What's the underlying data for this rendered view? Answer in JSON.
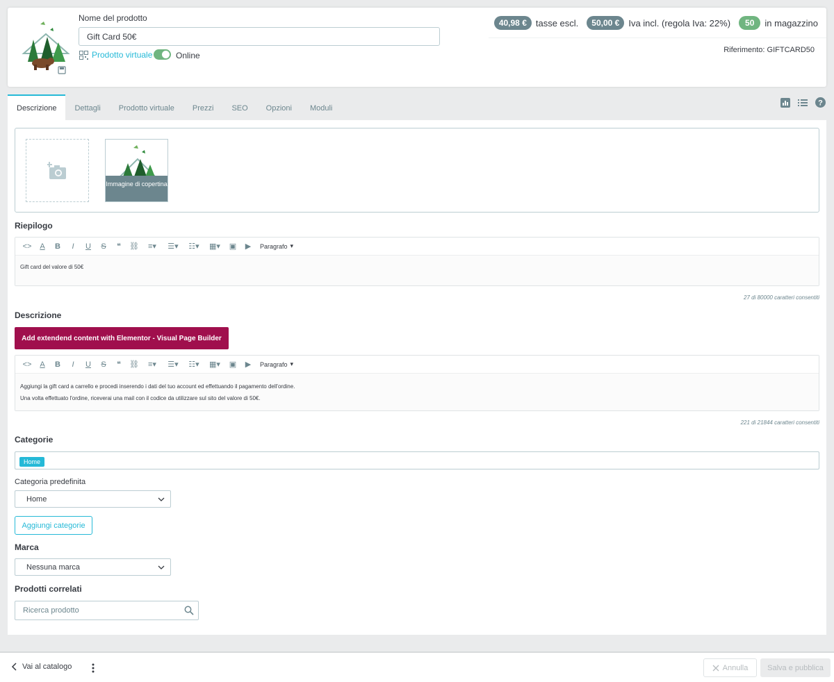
{
  "header": {
    "name_label": "Nome del prodotto",
    "name_value": "Gift Card 50€",
    "virtual_label": "Prodotto virtuale",
    "online_label": "Online",
    "online_enabled": true,
    "price_excl": "40,98 €",
    "price_excl_label": "tasse escl.",
    "price_incl": "50,00 €",
    "price_incl_label": "Iva incl. (regola Iva: 22%)",
    "stock": "50",
    "stock_label": "in magazzino",
    "reference": "Riferimento: GIFTCARD50"
  },
  "tabs": [
    {
      "label": "Descrizione",
      "active": true
    },
    {
      "label": "Dettagli"
    },
    {
      "label": "Prodotto virtuale"
    },
    {
      "label": "Prezzi"
    },
    {
      "label": "SEO"
    },
    {
      "label": "Opzioni"
    },
    {
      "label": "Moduli"
    }
  ],
  "images": {
    "cover_label": "Immagine di copertina"
  },
  "summary": {
    "title": "Riepilogo",
    "paragraph_label": "Paragrafo",
    "text": "Gift card del valore di 50€",
    "counter": "27 di 80000 caratteri consentiti"
  },
  "description": {
    "title": "Descrizione",
    "elementor_button": "Add extendend content with Elementor - Visual Page Builder",
    "paragraph_label": "Paragrafo",
    "line1": "Aggiungi la gift card a carrello e procedi inserendo i dati del tuo account ed effettuando il pagamento dell'ordine.",
    "line2": "Una volta effettuato l'ordine, riceverai una mail con il codice da utilizzare sul sito del valore di 50€.",
    "counter": "221 di 21844 caratteri consentiti"
  },
  "categories": {
    "title": "Categorie",
    "tag": "Home",
    "default_label": "Categoria predefinita",
    "default_value": "Home",
    "add_button": "Aggiungi categorie"
  },
  "brand": {
    "title": "Marca",
    "value": "Nessuna marca"
  },
  "related": {
    "title": "Prodotti correlati",
    "placeholder": "Ricerca prodotto"
  },
  "footer": {
    "back_label": "Vai al catalogo",
    "cancel_label": "Annulla",
    "save_label": "Salva e pubblica"
  },
  "colors": {
    "accent": "#25b9d7",
    "success": "#70b580",
    "elementor": "#a00f4d",
    "badge": "#6c868e"
  }
}
